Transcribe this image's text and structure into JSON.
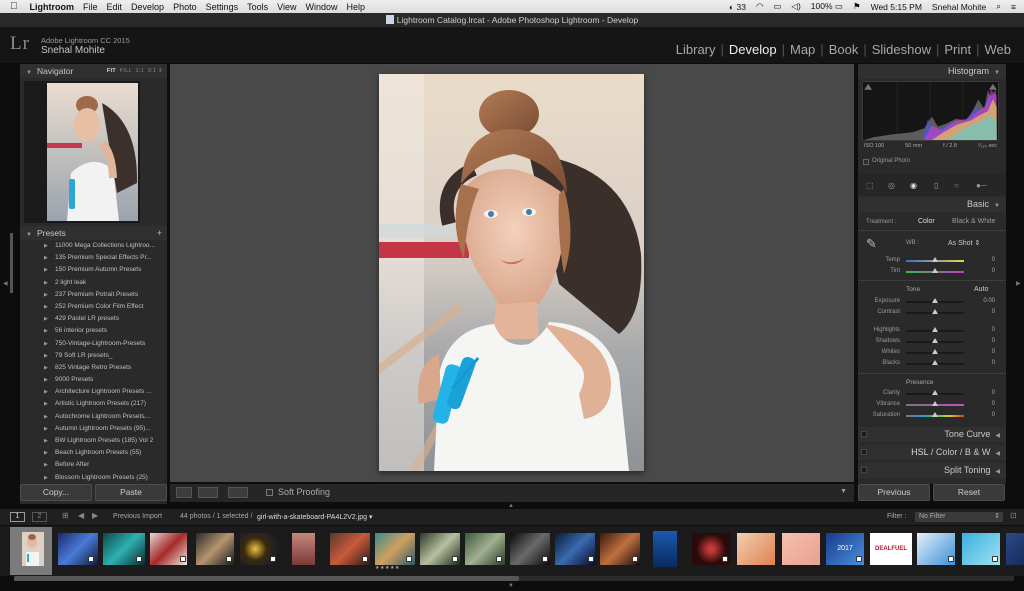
{
  "menubar": {
    "app": "Lightroom",
    "items": [
      "File",
      "Edit",
      "Develop",
      "Photo",
      "Settings",
      "Tools",
      "View",
      "Window",
      "Help"
    ],
    "status_count": "33",
    "battery": "100%",
    "clock": "Wed 5:15 PM",
    "user": "Snehal Mohite"
  },
  "window_title": "Lightroom Catalog.lrcat - Adobe Photoshop Lightroom - Develop",
  "identity": {
    "logo": "Lr",
    "version": "Adobe Lightroom CC 2015",
    "user": "Snehal Mohite"
  },
  "modules": [
    "Library",
    "Develop",
    "Map",
    "Book",
    "Slideshow",
    "Print",
    "Web"
  ],
  "active_module": "Develop",
  "navigator": {
    "title": "Navigator",
    "zoom": [
      "FIT",
      "FILL",
      "1:1",
      "3:1"
    ]
  },
  "presets": {
    "title": "Presets",
    "items": [
      "11000 Mega Collections Lightroo...",
      "135 Premium Special Effects Pr...",
      "150 Premium Autumn Presets",
      "2 light leak",
      "237 Premium Potrait Presets",
      "252 Premium Color Film Effect",
      "429 Pastel LR presets",
      "56 interior presets",
      "750-Vintage-Lightroom-Presets",
      "79 Soft LR presets_",
      "825 Vintage Retro Presets",
      "9000 Presets",
      "Architecture Lightroom Presets ...",
      "Artistic Lightroom Presets (217)",
      "Autochrome Lightroom Presets...",
      "Autumn Lightroom Presets (95)...",
      "BW Lightroom Presets (185) Vol 2",
      "Beach Lightroom Presets (55)",
      "Before After",
      "Blossom Lightroom Presets (25)"
    ]
  },
  "left_buttons": {
    "copy": "Copy...",
    "paste": "Paste"
  },
  "toolbar": {
    "soft_proofing": "Soft Proofing"
  },
  "histogram": {
    "title": "Histogram",
    "iso": "ISO 100",
    "focal": "50 mm",
    "aperture": "f / 2.8",
    "shutter": "¹⁄₁₂₅ sec",
    "original_photo": "Original Photo"
  },
  "basic": {
    "title": "Basic",
    "treatment_label": "Treatment :",
    "color": "Color",
    "bw": "Black & White",
    "wb_label": "WB :",
    "wb_value": "As Shot",
    "tone_label": "Tone",
    "auto": "Auto",
    "presence_label": "Presence",
    "sliders": [
      {
        "label": "Temp",
        "value": "0"
      },
      {
        "label": "Tint",
        "value": "0"
      },
      {
        "label": "Exposure",
        "value": "0.00"
      },
      {
        "label": "Contrast",
        "value": "0"
      },
      {
        "label": "Highlights",
        "value": "0"
      },
      {
        "label": "Shadows",
        "value": "0"
      },
      {
        "label": "Whites",
        "value": "0"
      },
      {
        "label": "Blacks",
        "value": "0"
      },
      {
        "label": "Clarity",
        "value": "0"
      },
      {
        "label": "Vibrance",
        "value": "0"
      },
      {
        "label": "Saturation",
        "value": "0"
      }
    ]
  },
  "panels": {
    "tone_curve": "Tone Curve",
    "hsl": "HSL",
    "hsl_color": "Color",
    "hsl_bw": "B & W",
    "split_toning": "Split Toning"
  },
  "right_buttons": {
    "previous": "Previous",
    "reset": "Reset"
  },
  "filmbar": {
    "page1": "1",
    "page2": "2",
    "source": "Previous Import",
    "count": "44 photos / 1 selected /",
    "filename": "girl-with-a-skateboard-PA4L2V2.jpg",
    "filter_label": "Filter :",
    "filter_value": "No Filter"
  },
  "filmstrip_badges": {
    "dealfuel": "DEALFUEL",
    "year": "2017",
    "stars": "★★★★★"
  }
}
